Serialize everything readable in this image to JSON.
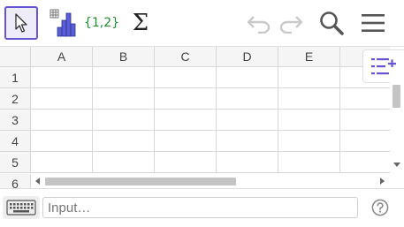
{
  "toolbar": {
    "tools": [
      {
        "id": "move",
        "icon": "cursor-arrow-icon",
        "active": true
      },
      {
        "id": "chart",
        "icon": "bar-chart-icon"
      },
      {
        "id": "list",
        "icon": "list-braces-icon",
        "label": "{1,2}"
      },
      {
        "id": "sum",
        "icon": "sigma-icon",
        "label": "Σ"
      }
    ],
    "right_icons": [
      "undo-icon",
      "redo-icon",
      "search-icon",
      "hamburger-menu-icon"
    ]
  },
  "sheet": {
    "columns": [
      "A",
      "B",
      "C",
      "D",
      "E"
    ],
    "rows": [
      "1",
      "2",
      "3",
      "4",
      "5"
    ],
    "partial_row": "6"
  },
  "input_bar": {
    "placeholder": "Input…",
    "keyboard_icon": "keyboard-icon",
    "help_icon": "help-icon"
  },
  "colors": {
    "accent": "#6557d2",
    "list_green": "#1e8f2b",
    "chart_blue": "#5a5fd8"
  }
}
